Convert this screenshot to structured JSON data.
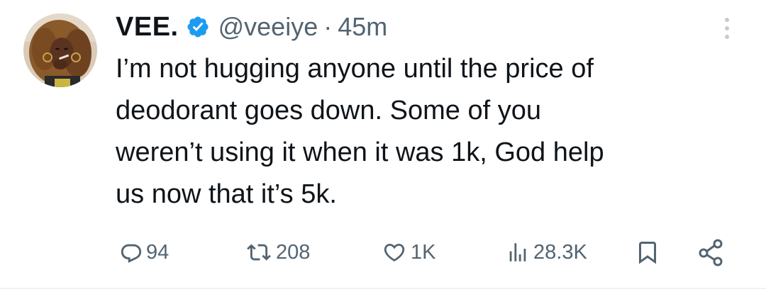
{
  "tweet": {
    "display_name": "VEE.",
    "handle": "@veeiye",
    "separator": "·",
    "time": "45m",
    "text_lines": [
      "I’m not hugging anyone until the price of",
      "deodorant goes down. Some of you",
      "weren’t using it when it was 1k, God help",
      "us now that it’s 5k."
    ],
    "verified_color": "#1d9bf0"
  },
  "actions": {
    "replies": "94",
    "retweets": "208",
    "likes": "1K",
    "views": "28.3K"
  },
  "icons": {
    "reply": "reply-icon",
    "retweet": "retweet-icon",
    "like": "heart-icon",
    "views": "views-icon",
    "bookmark": "bookmark-icon",
    "share": "share-icon",
    "more": "more-vertical-icon",
    "verified": "verified-badge-icon"
  },
  "colors": {
    "text": "#0f1419",
    "secondary": "#536471",
    "accent": "#1d9bf0"
  }
}
